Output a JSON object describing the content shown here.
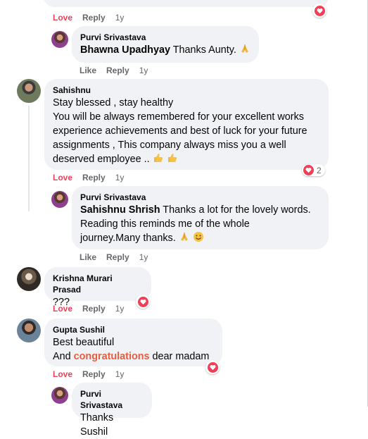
{
  "colors": {
    "bubble": "#f0f2f5",
    "love": "#f33e58",
    "meta": "#65676b",
    "highlight": "#e85d3d"
  },
  "comments": [
    {
      "id": "top_actions",
      "love": "Love",
      "reply": "Reply",
      "time": "1y"
    },
    {
      "id": "purvi_reply_1",
      "author": "Purvi Srivastava",
      "mention": "Bhawna Upadhyay",
      "text": "Thanks Aunty.",
      "emoji": "folded-hands",
      "like": "Like",
      "reply": "Reply",
      "time": "1y"
    },
    {
      "id": "sahishnu",
      "author": "Sahishnu",
      "lines": [
        "Stay blessed , stay healthy",
        "You will be always remembered for your excellent works",
        "experience achievements and best of luck for your future",
        "assignments , This company always miss you a well",
        "deserved employee .."
      ],
      "emoji": "thumbs-up",
      "love": "Love",
      "reply": "Reply",
      "time": "1y",
      "reaction_count": "2"
    },
    {
      "id": "purvi_reply_2",
      "author": "Purvi Srivastava",
      "mention": "Sahishnu Shrish",
      "lines": [
        "Thanks a lot for the lovely words.",
        "Reading this reminds me of the whole",
        "journey.Many thanks."
      ],
      "like": "Like",
      "reply": "Reply",
      "time": "1y"
    },
    {
      "id": "krishna",
      "author": "Krishna Murari Prasad",
      "text": "???",
      "love": "Love",
      "reply": "Reply",
      "time": "1y"
    },
    {
      "id": "gupta",
      "author": "Gupta Sushil",
      "line1": "Best beautiful",
      "line2_pre": "And",
      "line2_highlight": "congratulations",
      "line2_post": "dear madam",
      "love": "Love",
      "reply": "Reply",
      "time": "1y"
    },
    {
      "id": "purvi_reply_3",
      "author": "Purvi Srivastava",
      "text": "Thanks Sushil"
    }
  ]
}
